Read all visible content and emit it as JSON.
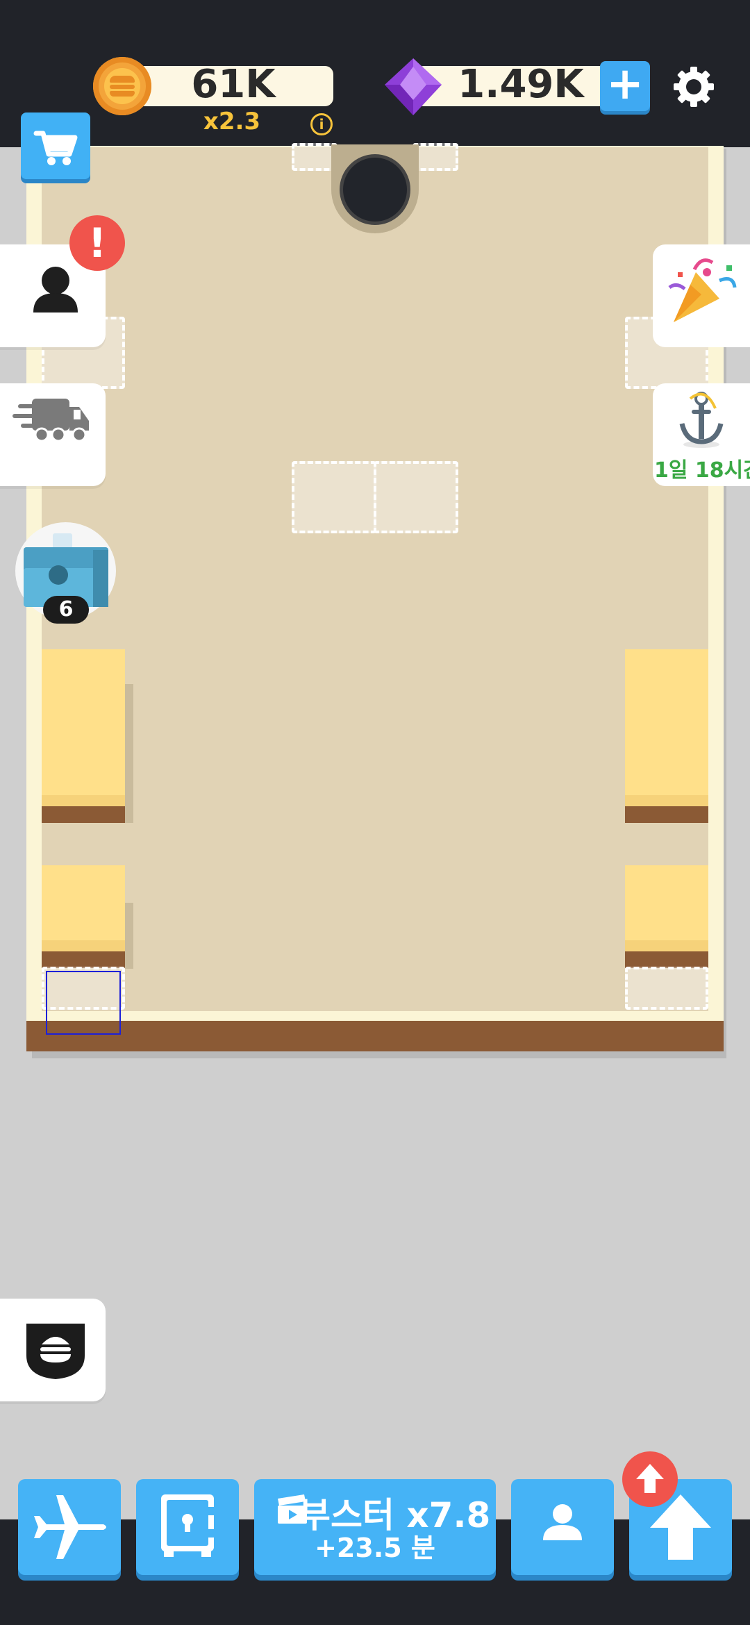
{
  "currency": {
    "coins": "61K",
    "coin_multiplier": "x2.3",
    "gems": "1.49K"
  },
  "side_left": {
    "alert_mark": "!",
    "chest_count": "6"
  },
  "side_right": {
    "anchor_timer": "1일 18시간"
  },
  "bottom_nav": {
    "booster_label": "부스터 x7.8",
    "booster_sub": "+23.5 분"
  },
  "colors": {
    "accent_blue": "#45b3f6",
    "alert_red": "#f0544c",
    "gold": "#f7c33b",
    "board_floor": "#e1d3b5",
    "table_yellow": "#ffe08a"
  },
  "icons": [
    "coin-icon",
    "gem-icon",
    "plus-icon",
    "gear-icon",
    "cart-icon",
    "person-icon",
    "truck-icon",
    "party-popper-icon",
    "anchor-icon",
    "chest-icon",
    "burger-shield-icon",
    "airplane-icon",
    "safe-icon",
    "clapperboard-icon",
    "arrow-up-icon"
  ]
}
